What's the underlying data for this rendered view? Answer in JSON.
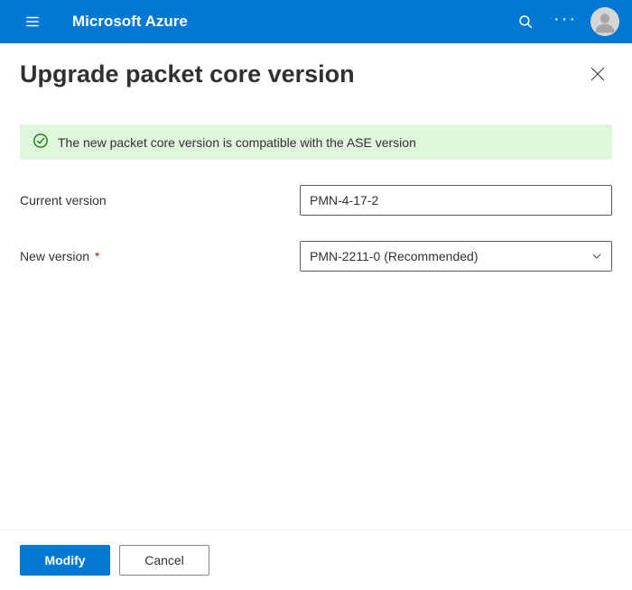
{
  "header": {
    "brand": "Microsoft Azure"
  },
  "page": {
    "title": "Upgrade packet core version"
  },
  "banner": {
    "message": "The new packet core version is compatible with the ASE version",
    "status_color": "#107c10"
  },
  "form": {
    "current_version": {
      "label": "Current version",
      "value": "PMN-4-17-2"
    },
    "new_version": {
      "label": "New version",
      "selected": "PMN-2211-0 (Recommended)"
    }
  },
  "footer": {
    "primary_label": "Modify",
    "secondary_label": "Cancel"
  }
}
